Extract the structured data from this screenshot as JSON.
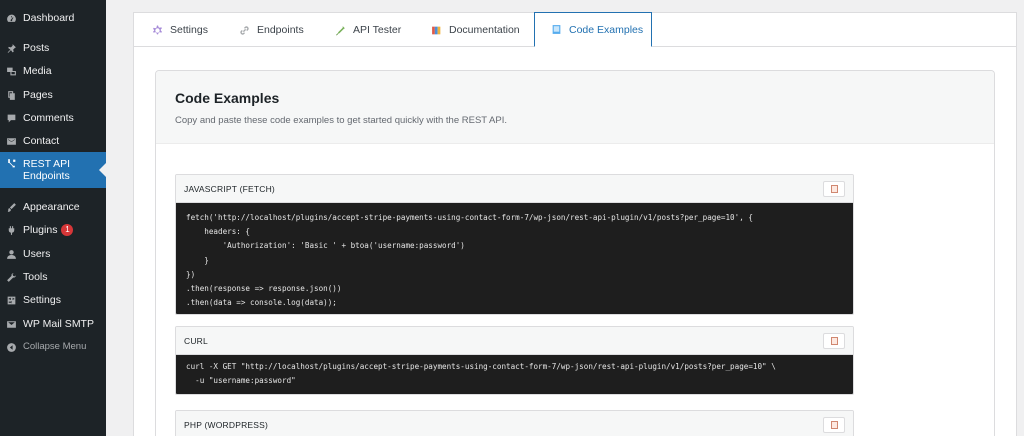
{
  "sidebar": {
    "items": [
      {
        "label": "Dashboard",
        "icon": "dashboard-icon"
      },
      {
        "label": "Posts",
        "icon": "pin-icon"
      },
      {
        "label": "Media",
        "icon": "media-icon"
      },
      {
        "label": "Pages",
        "icon": "pages-icon"
      },
      {
        "label": "Comments",
        "icon": "comments-icon"
      },
      {
        "label": "Contact",
        "icon": "mail-icon"
      },
      {
        "label": "REST API\nEndpoints",
        "icon": "rest-api-icon",
        "active": true
      },
      {
        "label": "Appearance",
        "icon": "appearance-icon"
      },
      {
        "label": "Plugins",
        "icon": "plugins-icon",
        "badge": "1"
      },
      {
        "label": "Users",
        "icon": "users-icon"
      },
      {
        "label": "Tools",
        "icon": "tools-icon"
      },
      {
        "label": "Settings",
        "icon": "settings-icon"
      },
      {
        "label": "WP Mail SMTP",
        "icon": "smtp-icon"
      },
      {
        "label": "Collapse Menu",
        "icon": "collapse-icon"
      }
    ]
  },
  "tabs": [
    {
      "label": "Settings",
      "icon": "gear-icon"
    },
    {
      "label": "Endpoints",
      "icon": "link-icon"
    },
    {
      "label": "API Tester",
      "icon": "syringe-icon"
    },
    {
      "label": "Documentation",
      "icon": "books-icon"
    },
    {
      "label": "Code Examples",
      "icon": "book-icon",
      "active": true
    }
  ],
  "panel": {
    "title": "Code Examples",
    "description": "Copy and paste these code examples to get started quickly with the REST API."
  },
  "blocks": [
    {
      "label": "JAVASCRIPT (FETCH)",
      "code": "fetch('http://localhost/plugins/accept-stripe-payments-using-contact-form-7/wp-json/rest-api-plugin/v1/posts?per_page=10', {\n    headers: {\n        'Authorization': 'Basic ' + btoa('username:password')\n    }\n})\n.then(response => response.json())\n.then(data => console.log(data));"
    },
    {
      "label": "CURL",
      "code": "curl -X GET \"http://localhost/plugins/accept-stripe-payments-using-contact-form-7/wp-json/rest-api-plugin/v1/posts?per_page=10\" \\\n  -u \"username:password\""
    },
    {
      "label": "PHP (WORDPRESS)",
      "code": ""
    }
  ],
  "colors": {
    "sidebar_bg": "#1d2327",
    "accent": "#2271b1",
    "code_bg": "#1e1e1e",
    "badge": "#d63638"
  }
}
